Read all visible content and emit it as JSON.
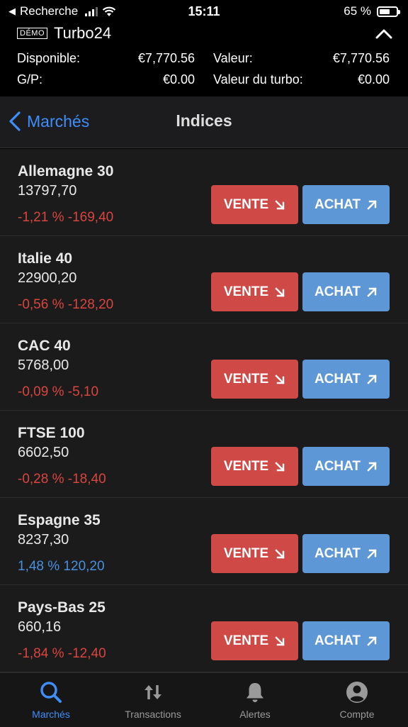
{
  "status": {
    "back_app": "Recherche",
    "time": "15:11",
    "battery": "65 %",
    "battery_level": 0.65
  },
  "account": {
    "badge": "DÉMO",
    "name": "Turbo24",
    "available_label": "Disponible:",
    "available_value": "€7,770.56",
    "value_label": "Valeur:",
    "value_value": "€7,770.56",
    "pl_label": "G/P:",
    "pl_value": "€0.00",
    "turbo_label": "Valeur du turbo:",
    "turbo_value": "€0.00"
  },
  "nav": {
    "back_label": "Marchés",
    "title": "Indices"
  },
  "buttons": {
    "sell": "VENTE",
    "buy": "ACHAT"
  },
  "markets": [
    {
      "name": "Allemagne 30",
      "price": "13797,70",
      "change": "-1,21 % -169,40",
      "direction": "down"
    },
    {
      "name": "Italie 40",
      "price": "22900,20",
      "change": "-0,56 % -128,20",
      "direction": "down"
    },
    {
      "name": "CAC 40",
      "price": "5768,00",
      "change": "-0,09 % -5,10",
      "direction": "down"
    },
    {
      "name": "FTSE 100",
      "price": "6602,50",
      "change": "-0,28 % -18,40",
      "direction": "down"
    },
    {
      "name": "Espagne 35",
      "price": "8237,30",
      "change": "1,48 % 120,20",
      "direction": "up"
    },
    {
      "name": "Pays-Bas 25",
      "price": "660,16",
      "change": "-1,84 % -12,40",
      "direction": "down"
    }
  ],
  "tabs": [
    {
      "label": "Marchés",
      "icon": "search-icon",
      "active": true
    },
    {
      "label": "Transactions",
      "icon": "transfer-arrows-icon",
      "active": false
    },
    {
      "label": "Alertes",
      "icon": "bell-icon",
      "active": false
    },
    {
      "label": "Compte",
      "icon": "user-circle-icon",
      "active": false
    }
  ]
}
